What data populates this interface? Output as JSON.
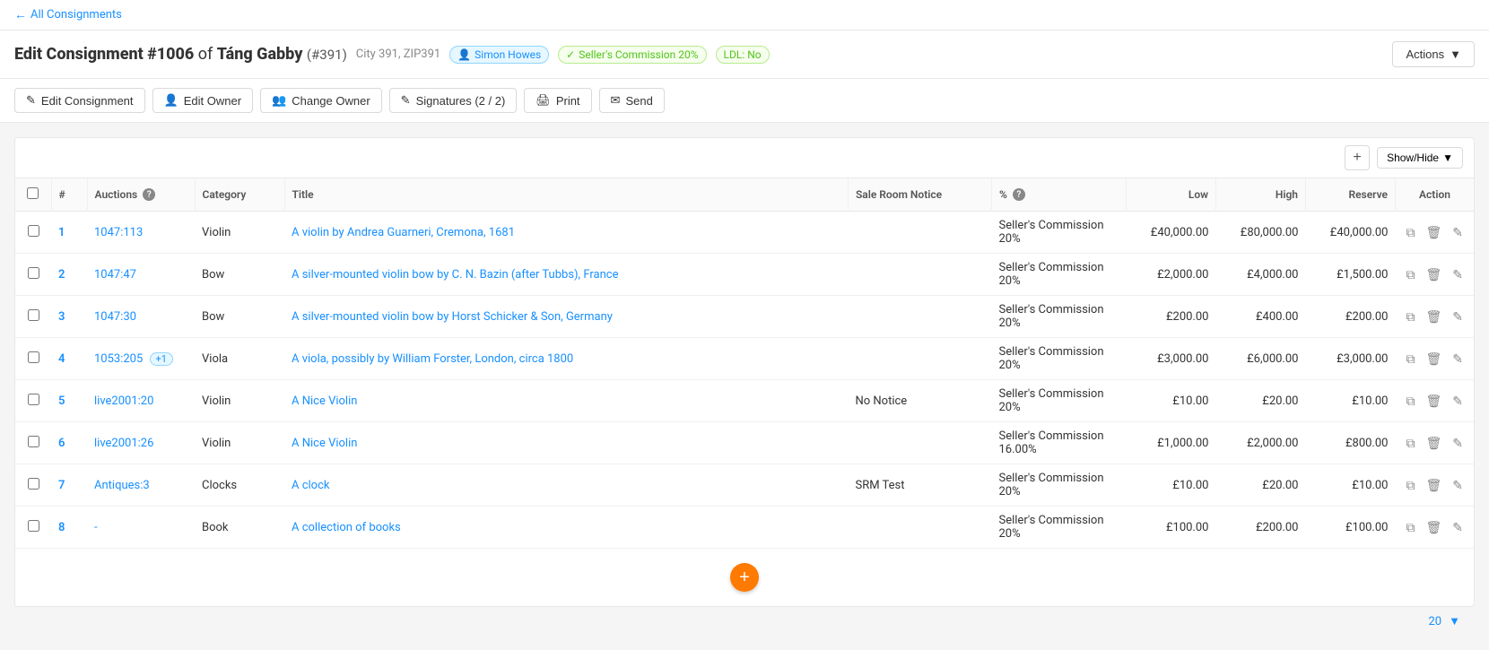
{
  "nav": {
    "back_label": "All Consignments"
  },
  "header": {
    "title_prefix": "Edit Consignment",
    "consignment_id": "#1006",
    "of": "of",
    "owner_name": "Táng Gabby",
    "owner_id": "(#391)",
    "location": "City 391, ZIP391",
    "user_badge": "Simon Howes",
    "commission_badge": "Seller's Commission 20%",
    "ldl_badge": "LDL: No",
    "actions_label": "Actions"
  },
  "toolbar": {
    "edit_consignment": "Edit Consignment",
    "edit_owner": "Edit Owner",
    "change_owner": "Change Owner",
    "signatures": "Signatures (2 / 2)",
    "print": "Print",
    "send": "Send"
  },
  "table": {
    "show_hide_label": "Show/Hide",
    "columns": {
      "num": "#",
      "auctions": "Auctions",
      "category": "Category",
      "title": "Title",
      "sale_room_notice": "Sale Room Notice",
      "percent": "%",
      "low": "Low",
      "high": "High",
      "reserve": "Reserve",
      "action": "Action"
    },
    "rows": [
      {
        "num": "1",
        "auctions": "1047:113",
        "category": "Violin",
        "title": "A violin by Andrea Guarneri, Cremona, 1681",
        "sale_room_notice": "",
        "percent": "Seller's Commission 20%",
        "low": "£40,000.00",
        "high": "£80,000.00",
        "reserve": "£40,000.00",
        "plus": null
      },
      {
        "num": "2",
        "auctions": "1047:47",
        "category": "Bow",
        "title": "A silver-mounted violin bow by C. N. Bazin (after Tubbs), France",
        "sale_room_notice": "",
        "percent": "Seller's Commission 20%",
        "low": "£2,000.00",
        "high": "£4,000.00",
        "reserve": "£1,500.00",
        "plus": null
      },
      {
        "num": "3",
        "auctions": "1047:30",
        "category": "Bow",
        "title": "A silver-mounted violin bow by Horst Schicker & Son, Germany",
        "sale_room_notice": "",
        "percent": "Seller's Commission 20%",
        "low": "£200.00",
        "high": "£400.00",
        "reserve": "£200.00",
        "plus": null
      },
      {
        "num": "4",
        "auctions": "1053:205",
        "category": "Viola",
        "title": "A viola, possibly by William Forster, London, circa 1800",
        "sale_room_notice": "",
        "percent": "Seller's Commission 20%",
        "low": "£3,000.00",
        "high": "£6,000.00",
        "reserve": "£3,000.00",
        "plus": "+1"
      },
      {
        "num": "5",
        "auctions": "live2001:20",
        "category": "Violin",
        "title": "A Nice Violin",
        "sale_room_notice": "No Notice",
        "percent": "Seller's Commission 20%",
        "low": "£10.00",
        "high": "£20.00",
        "reserve": "£10.00",
        "plus": null
      },
      {
        "num": "6",
        "auctions": "live2001:26",
        "category": "Violin",
        "title": "A Nice Violin",
        "sale_room_notice": "",
        "percent": "Seller's Commission 16.00%",
        "low": "£1,000.00",
        "high": "£2,000.00",
        "reserve": "£800.00",
        "plus": null
      },
      {
        "num": "7",
        "auctions": "Antiques:3",
        "category": "Clocks",
        "title": "A clock",
        "sale_room_notice": "SRM Test",
        "percent": "Seller's Commission 20%",
        "low": "£10.00",
        "high": "£20.00",
        "reserve": "£10.00",
        "plus": null
      },
      {
        "num": "8",
        "auctions": "-",
        "category": "Book",
        "title": "A collection of books",
        "sale_room_notice": "",
        "percent": "Seller's Commission 20%",
        "low": "£100.00",
        "high": "£200.00",
        "reserve": "£100.00",
        "plus": null
      }
    ]
  },
  "pagination": {
    "per_page": "20"
  }
}
